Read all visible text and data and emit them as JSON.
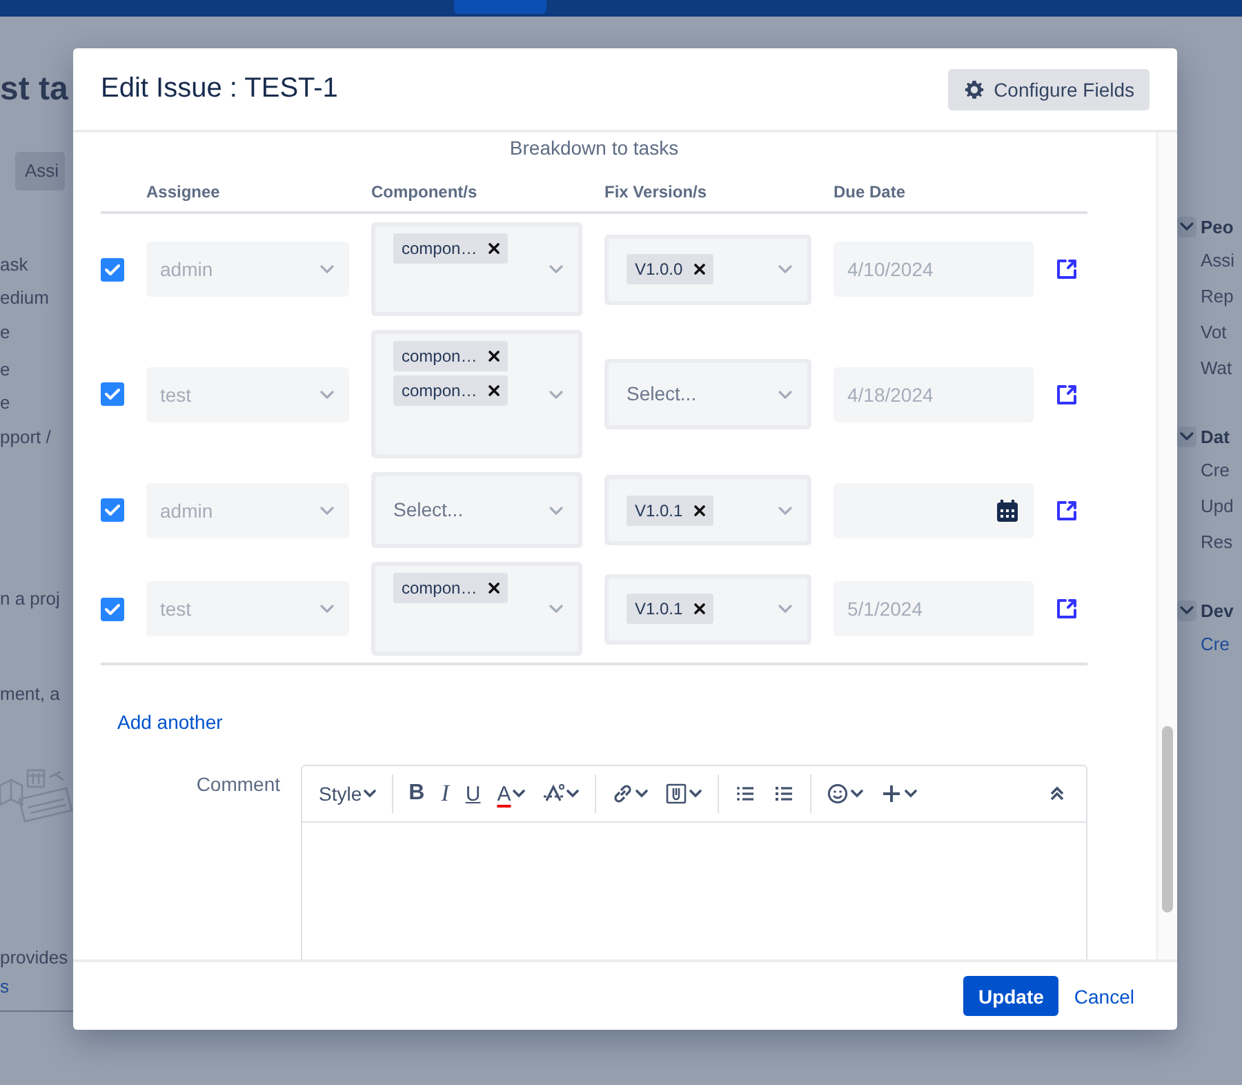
{
  "background_page": {
    "left": [
      {
        "kind": "heading",
        "text": "st ta"
      },
      {
        "kind": "button",
        "text": "Assi"
      },
      {
        "kind": "text",
        "text": "ask"
      },
      {
        "kind": "text",
        "text": "edium"
      },
      {
        "kind": "text",
        "text": "e"
      },
      {
        "kind": "text",
        "text": "e"
      },
      {
        "kind": "text",
        "text": "e"
      },
      {
        "kind": "text",
        "text": "pport /"
      },
      {
        "kind": "text",
        "text": "n a proj"
      },
      {
        "kind": "text",
        "text": "ment, a"
      },
      {
        "kind": "illustration"
      },
      {
        "kind": "text",
        "text": "provides"
      },
      {
        "kind": "link",
        "text": "s"
      }
    ],
    "right": [
      {
        "title": "Peo",
        "expanded": true,
        "items": [
          {
            "kind": "text",
            "text": "Assi"
          },
          {
            "kind": "text",
            "text": "Rep"
          },
          {
            "kind": "text",
            "text": "Vot"
          },
          {
            "kind": "text",
            "text": "Wat"
          }
        ]
      },
      {
        "title": "Dat",
        "expanded": true,
        "items": [
          {
            "kind": "text",
            "text": "Cre"
          },
          {
            "kind": "text",
            "text": "Upd"
          },
          {
            "kind": "text",
            "text": "Res"
          }
        ]
      },
      {
        "title": "Dev",
        "expanded": true,
        "items": [
          {
            "kind": "link",
            "text": "Cre"
          }
        ]
      }
    ]
  },
  "dialog": {
    "title": "Edit Issue : TEST-1",
    "configure_button": "Configure Fields",
    "section_title": "Breakdown to tasks",
    "columns": [
      "Assignee",
      "Component/s",
      "Fix Version/s",
      "Due Date"
    ],
    "rows": [
      {
        "checked": true,
        "assignee": "admin",
        "components": {
          "tags": [
            "compon…"
          ]
        },
        "fix_versions": {
          "tags": [
            "V1.0.0"
          ]
        },
        "due_date": "4/10/2024"
      },
      {
        "checked": true,
        "assignee": "test",
        "components": {
          "tags": [
            "compon…",
            "compon…"
          ]
        },
        "fix_versions": {
          "placeholder": "Select..."
        },
        "due_date": "4/18/2024"
      },
      {
        "checked": true,
        "assignee": "admin",
        "components": {
          "placeholder": "Select..."
        },
        "fix_versions": {
          "tags": [
            "V1.0.1"
          ]
        },
        "due_date": ""
      },
      {
        "checked": true,
        "assignee": "test",
        "components": {
          "tags": [
            "compon…"
          ]
        },
        "fix_versions": {
          "tags": [
            "V1.0.1"
          ]
        },
        "due_date": "5/1/2024"
      }
    ],
    "add_link": "Add another",
    "comment_label": "Comment",
    "toolbar": [
      {
        "kind": "style",
        "label": "Style",
        "caret": true
      },
      {
        "kind": "divider"
      },
      {
        "kind": "bold",
        "label": "B",
        "caret": false
      },
      {
        "kind": "italic",
        "label": "I",
        "caret": false
      },
      {
        "kind": "underline",
        "label": "U",
        "caret": false
      },
      {
        "kind": "color",
        "label": "A",
        "caret": true
      },
      {
        "kind": "clear-format",
        "caret": true
      },
      {
        "kind": "divider"
      },
      {
        "kind": "link",
        "caret": true
      },
      {
        "kind": "attachment",
        "caret": true
      },
      {
        "kind": "divider"
      },
      {
        "kind": "bullets",
        "caret": false
      },
      {
        "kind": "numbering",
        "caret": false
      },
      {
        "kind": "divider"
      },
      {
        "kind": "emoji",
        "caret": true
      },
      {
        "kind": "insert",
        "caret": true
      },
      {
        "kind": "collapse",
        "caret": false
      }
    ],
    "primary_button": "Update",
    "cancel_link": "Cancel"
  }
}
